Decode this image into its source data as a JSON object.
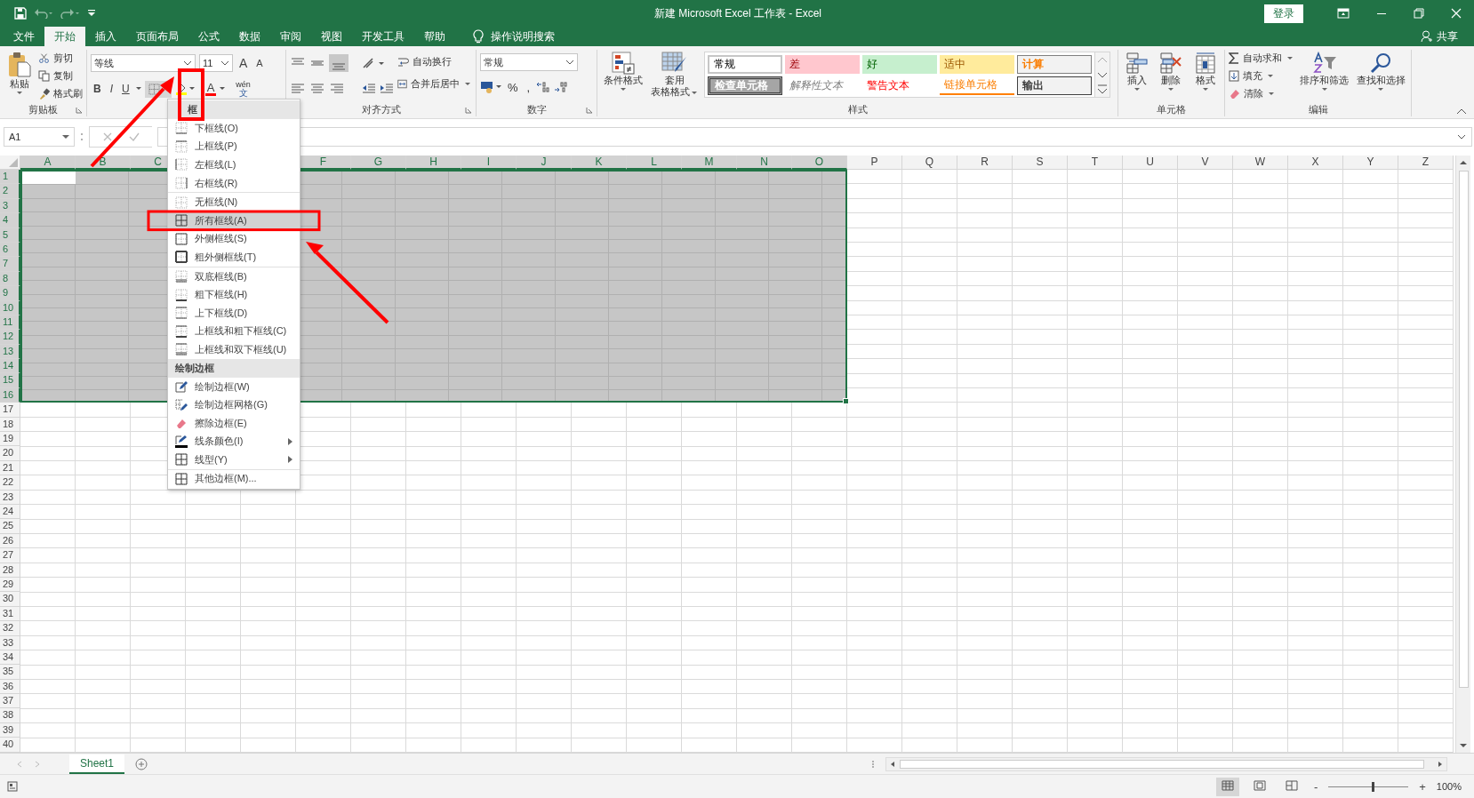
{
  "window": {
    "title": "新建 Microsoft Excel 工作表  -  Excel",
    "sign_in": "登录"
  },
  "tabs": [
    {
      "label": "文件",
      "selected": false
    },
    {
      "label": "开始",
      "selected": true
    },
    {
      "label": "插入",
      "selected": false
    },
    {
      "label": "页面布局",
      "selected": false
    },
    {
      "label": "公式",
      "selected": false
    },
    {
      "label": "数据",
      "selected": false
    },
    {
      "label": "审阅",
      "selected": false
    },
    {
      "label": "视图",
      "selected": false
    },
    {
      "label": "开发工具",
      "selected": false
    },
    {
      "label": "帮助",
      "selected": false
    }
  ],
  "tell_me": "操作说明搜索",
  "share": "共享",
  "ribbon": {
    "clipboard": {
      "title": "剪贴板",
      "paste": "粘贴",
      "cut": "剪切",
      "copy": "复制",
      "format_painter": "格式刷"
    },
    "font": {
      "name": "等线",
      "size": "11",
      "grow": "A",
      "shrink": "A",
      "bold": "B",
      "italic": "I",
      "underline": "U",
      "font_color": "A",
      "phonetic_top": "wén",
      "phonetic_bottom": "文"
    },
    "alignment": {
      "title": "对齐方式",
      "wrap": "自动换行",
      "merge": "合并后居中"
    },
    "number": {
      "title": "数字",
      "format": "常规",
      "percent": "%",
      "comma": ","
    },
    "styles": {
      "title": "样式",
      "conditional": "条件格式",
      "table_top": "套用",
      "table_bottom": "表格格式",
      "cells": [
        {
          "label": "常规",
          "kind": "normal"
        },
        {
          "label": "差",
          "kind": "bad"
        },
        {
          "label": "好",
          "kind": "good"
        },
        {
          "label": "适中",
          "kind": "neutral"
        },
        {
          "label": "计算",
          "kind": "calculation"
        },
        {
          "label": "检查单元格",
          "kind": "check"
        },
        {
          "label": "解释性文本",
          "kind": "explanatory"
        },
        {
          "label": "警告文本",
          "kind": "warning"
        },
        {
          "label": "链接单元格",
          "kind": "linked"
        },
        {
          "label": "输出",
          "kind": "output"
        }
      ]
    },
    "cells": {
      "title": "单元格",
      "insert": "插入",
      "delete": "删除",
      "format": "格式"
    },
    "editing": {
      "title": "编辑",
      "autosum": "自动求和",
      "fill": "填充",
      "clear": "清除",
      "sort": "排序和筛选",
      "find": "查找和选择"
    }
  },
  "name_box": "A1",
  "columns": [
    {
      "label": "A",
      "selected": true
    },
    {
      "label": "B",
      "selected": true
    },
    {
      "label": "C",
      "selected": true
    },
    {},
    {},
    {
      "label": "F",
      "selected": true
    },
    {
      "label": "G",
      "selected": true
    },
    {
      "label": "H",
      "selected": true
    },
    {
      "label": "I",
      "selected": true
    },
    {
      "label": "J",
      "selected": true
    },
    {
      "label": "K",
      "selected": true
    },
    {
      "label": "L",
      "selected": true
    },
    {
      "label": "M",
      "selected": true
    },
    {
      "label": "N",
      "selected": true
    },
    {
      "label": "O",
      "selected": true
    },
    {
      "label": "P",
      "selected": false
    },
    {
      "label": "Q",
      "selected": false
    },
    {
      "label": "R",
      "selected": false
    },
    {
      "label": "S",
      "selected": false
    },
    {
      "label": "T",
      "selected": false
    },
    {
      "label": "U",
      "selected": false
    },
    {
      "label": "V",
      "selected": false
    },
    {
      "label": "W",
      "selected": false
    },
    {
      "label": "X",
      "selected": false
    },
    {
      "label": "Y",
      "selected": false
    },
    {
      "label": "Z",
      "selected": false
    }
  ],
  "rows": [
    {
      "label": "1",
      "selected": true
    },
    {
      "label": "2",
      "selected": true
    },
    {
      "label": "3",
      "selected": true
    },
    {
      "label": "4",
      "selected": true
    },
    {
      "label": "5",
      "selected": true
    },
    {
      "label": "6",
      "selected": true
    },
    {
      "label": "7",
      "selected": true
    },
    {
      "label": "8",
      "selected": true
    },
    {
      "label": "9",
      "selected": true
    },
    {
      "label": "10",
      "selected": true
    },
    {
      "label": "11",
      "selected": true
    },
    {
      "label": "12",
      "selected": true
    },
    {
      "label": "13",
      "selected": true
    },
    {
      "label": "14",
      "selected": true
    },
    {
      "label": "15",
      "selected": true
    },
    {
      "label": "16",
      "selected": true
    },
    {
      "label": "17",
      "selected": false
    },
    {
      "label": "18",
      "selected": false
    },
    {
      "label": "19",
      "selected": false
    },
    {
      "label": "20",
      "selected": false
    },
    {
      "label": "21",
      "selected": false
    },
    {
      "label": "22",
      "selected": false
    },
    {
      "label": "23",
      "selected": false
    },
    {
      "label": "24",
      "selected": false
    },
    {
      "label": "25",
      "selected": false
    },
    {
      "label": "26",
      "selected": false
    },
    {
      "label": "27",
      "selected": false
    },
    {
      "label": "28",
      "selected": false
    },
    {
      "label": "29",
      "selected": false
    },
    {
      "label": "30",
      "selected": false
    },
    {
      "label": "31",
      "selected": false
    },
    {
      "label": "32",
      "selected": false
    },
    {
      "label": "33",
      "selected": false
    },
    {
      "label": "34",
      "selected": false
    },
    {
      "label": "35",
      "selected": false
    },
    {
      "label": "36",
      "selected": false
    },
    {
      "label": "37",
      "selected": false
    },
    {
      "label": "38",
      "selected": false
    },
    {
      "label": "39",
      "selected": false
    },
    {
      "label": "40",
      "selected": false
    }
  ],
  "border_menu": {
    "items": [
      {
        "kind": "heading",
        "label": "框"
      },
      {
        "kind": "item",
        "label": "下框线(O)",
        "selected": false,
        "divider_above": false,
        "submenu": false
      },
      {
        "kind": "item",
        "label": "上框线(P)",
        "selected": false,
        "divider_above": false,
        "submenu": false
      },
      {
        "kind": "item",
        "label": "左框线(L)",
        "selected": false,
        "divider_above": false,
        "submenu": false
      },
      {
        "kind": "item",
        "label": "右框线(R)",
        "selected": false,
        "divider_above": false,
        "submenu": false
      },
      {
        "kind": "item",
        "label": "无框线(N)",
        "selected": false,
        "divider_above": true,
        "submenu": false
      },
      {
        "kind": "item",
        "label": "所有框线(A)",
        "selected": true,
        "divider_above": false,
        "submenu": false
      },
      {
        "kind": "item",
        "label": "外侧框线(S)",
        "selected": false,
        "divider_above": false,
        "submenu": false
      },
      {
        "kind": "item",
        "label": "粗外侧框线(T)",
        "selected": false,
        "divider_above": false,
        "submenu": false
      },
      {
        "kind": "item",
        "label": "双底框线(B)",
        "selected": false,
        "divider_above": true,
        "submenu": false
      },
      {
        "kind": "item",
        "label": "粗下框线(H)",
        "selected": false,
        "divider_above": false,
        "submenu": false
      },
      {
        "kind": "item",
        "label": "上下框线(D)",
        "selected": false,
        "divider_above": false,
        "submenu": false
      },
      {
        "kind": "item",
        "label": "上框线和粗下框线(C)",
        "selected": false,
        "divider_above": false,
        "submenu": false
      },
      {
        "kind": "item",
        "label": "上框线和双下框线(U)",
        "selected": false,
        "divider_above": false,
        "submenu": false
      },
      {
        "kind": "heading",
        "label": "绘制边框"
      },
      {
        "kind": "item",
        "label": "绘制边框(W)",
        "selected": false,
        "divider_above": false,
        "submenu": false
      },
      {
        "kind": "item",
        "label": "绘制边框网格(G)",
        "selected": false,
        "divider_above": false,
        "submenu": false
      },
      {
        "kind": "item",
        "label": "擦除边框(E)",
        "selected": false,
        "divider_above": false,
        "submenu": false
      },
      {
        "kind": "item",
        "label": "线条颜色(I)",
        "selected": false,
        "divider_above": false,
        "submenu": true
      },
      {
        "kind": "item",
        "label": "线型(Y)",
        "selected": false,
        "divider_above": false,
        "submenu": true
      },
      {
        "kind": "item",
        "label": "其他边框(M)...",
        "selected": false,
        "divider_above": true,
        "submenu": false
      }
    ]
  },
  "sheet_tabs": [
    {
      "label": "Sheet1",
      "selected": true
    }
  ],
  "zoom": {
    "minus": "-",
    "plus": "+",
    "level": 0.55,
    "reading": "100%"
  }
}
